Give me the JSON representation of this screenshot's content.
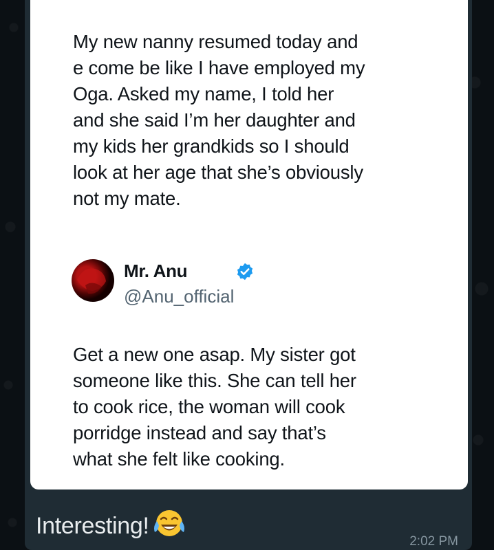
{
  "message": {
    "quoted_tweet_text": "My new nanny resumed today and\ne come be like I have employed my\nOga. Asked my name, I told her\nand she said I’m her daughter and\nmy kids her grandkids so I should\nlook at her age that she’s obviously\nnot my mate.",
    "reply": {
      "author_name": "Mr. Anu",
      "author_handle": "@Anu_official",
      "text": "Get a new one asap. My sister got\nsomeone like this. She can tell her\nto cook rice, the woman will cook\nporridge instead and say that’s\nwhat she felt like cooking.",
      "verified_icon": "verified-badge-icon"
    },
    "caption": "Interesting!",
    "caption_emoji": "face-with-tears-of-joy-icon",
    "timestamp": "2:02 PM"
  },
  "colors": {
    "chat_background": "#0b1014",
    "bubble": "#1f2c34",
    "verified_blue": "#1d9bf0",
    "handle_gray": "#536471",
    "timestamp_gray": "#8696a0"
  }
}
